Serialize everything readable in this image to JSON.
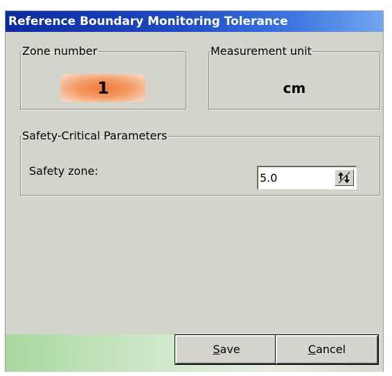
{
  "window": {
    "title": "Reference Boundary Monitoring Tolerance"
  },
  "zone": {
    "legend": "Zone number",
    "value": "1"
  },
  "unit": {
    "legend": "Measurement unit",
    "value": "cm"
  },
  "safety": {
    "legend": "Safety-Critical Parameters",
    "field_label": "Safety zone:",
    "field_value": "5.0"
  },
  "buttons": {
    "save": {
      "mnemonic": "S",
      "rest": "ave"
    },
    "cancel": {
      "mnemonic": "C",
      "rest": "ancel"
    }
  },
  "icons": {
    "spin": "up-down-arrows-icon"
  }
}
